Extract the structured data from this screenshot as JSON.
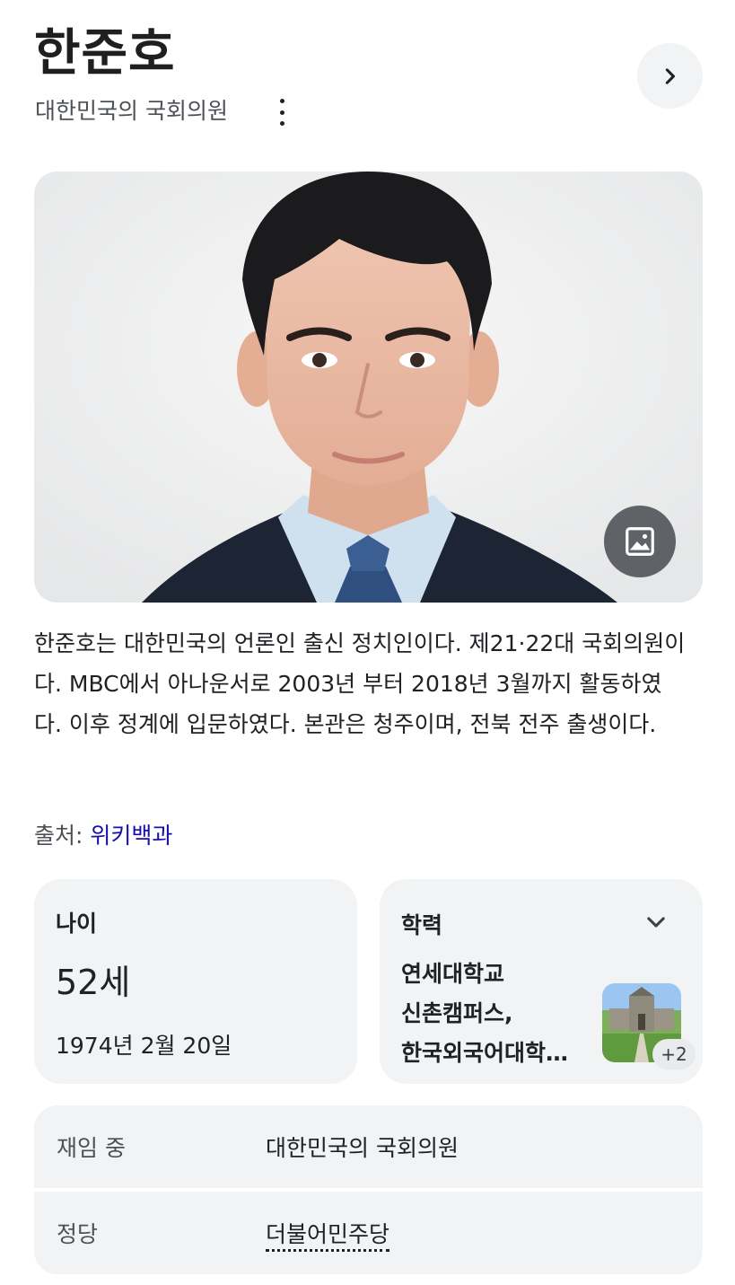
{
  "header": {
    "title": "한준호",
    "subtitle": "대한민국의 국회의원"
  },
  "description": "한준호는 대한민국의 언론인 출신 정치인이다. 제21·22대 국회의원이다. MBC에서 아나운서로 2003년 부터 2018년 3월까지 활동하였다. 이후 정계에 입문하였다. 본관은 청주이며, 전북 전주 출생이다.",
  "source": {
    "prefix": "출처: ",
    "link_label": "위키백과"
  },
  "age_card": {
    "label": "나이",
    "value": "52세",
    "birthdate": "1974년 2월 20일"
  },
  "education_card": {
    "label": "학력",
    "lines": [
      "연세대학교",
      "신촌캠퍼스,",
      "한국외국어대학…"
    ],
    "more_badge": "+2"
  },
  "info_rows": [
    {
      "label": "재임 중",
      "value": "대한민국의 국회의원"
    },
    {
      "label": "정당",
      "value": "더불어민주당"
    }
  ],
  "icons": {
    "next": "chevron-right-icon",
    "more": "more-vert-icon",
    "images": "image-icon",
    "expand": "chevron-down-icon"
  },
  "colors": {
    "link": "#1a0dab",
    "card_bg": "#f1f3f4",
    "button_dark": "#5f6368"
  }
}
